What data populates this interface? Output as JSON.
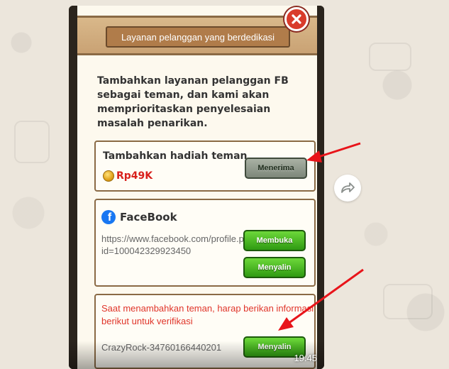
{
  "popup": {
    "header_title": "Layanan pelanggan yang berdedikasi",
    "intro_text": "Tambahkan layanan pelanggan FB sebagai teman, dan kami akan memprioritaskan penyelesaian masalah penarikan."
  },
  "gift": {
    "title": "Tambahkan hadiah teman",
    "price": "Rp49K",
    "accept_label": "Menerima"
  },
  "facebook": {
    "name": "FaceBook",
    "url": "https://www.facebook.com/profile.php?id=100042329923450",
    "open_label": "Membuka",
    "copy_label": "Menyalin"
  },
  "verify": {
    "text": "Saat menambahkan teman, harap berikan informasi berikut untuk verifikasi",
    "id": "CrazyRock-34760166440201",
    "copy_label": "Menyalin"
  },
  "video": {
    "timestamp": "19.45"
  },
  "colors": {
    "accent_red": "#e0352a",
    "button_green": "#2f9a12",
    "facebook_blue": "#1877f2",
    "header_brown": "#b07c4a"
  },
  "icons": [
    "close-icon",
    "coin-icon",
    "facebook-icon",
    "forward-icon",
    "annotation-arrow"
  ]
}
